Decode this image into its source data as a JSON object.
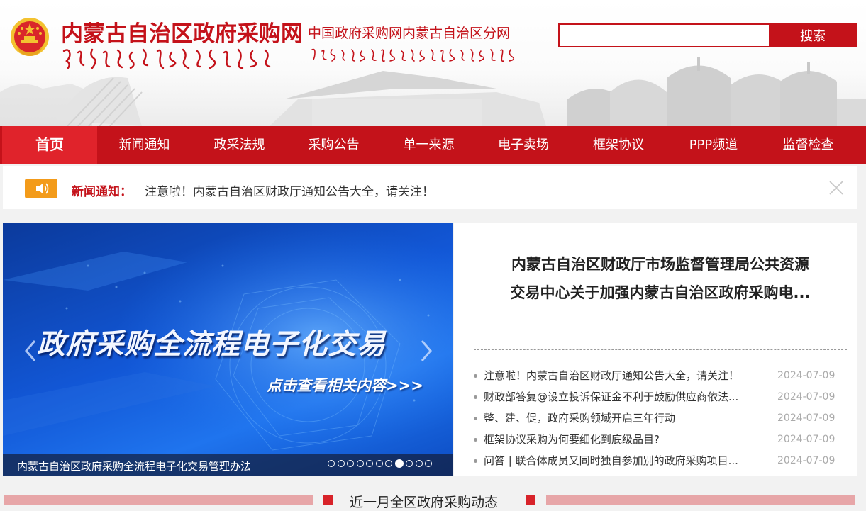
{
  "header": {
    "site_title": "内蒙古自治区政府采购网",
    "sub_title": "中国政府采购网内蒙古自治区分网",
    "emblem_icon": "national-emblem-icon",
    "search": {
      "placeholder": "",
      "button_label": "搜索"
    }
  },
  "nav": {
    "items": [
      {
        "label": "首页",
        "active": true
      },
      {
        "label": "新闻通知"
      },
      {
        "label": "政采法规"
      },
      {
        "label": "采购公告"
      },
      {
        "label": "单一来源"
      },
      {
        "label": "电子卖场"
      },
      {
        "label": "框架协议"
      },
      {
        "label": "PPP频道"
      },
      {
        "label": "监督检查"
      }
    ]
  },
  "notice": {
    "icon": "speaker-icon",
    "label": "新闻通知：",
    "text": "注意啦！内蒙古自治区财政厅通知公告大全，请关注！",
    "close_icon": "close-icon"
  },
  "carousel": {
    "headline": "政府采购全流程电子化交易",
    "cta": "点击查看相关内容>>>",
    "caption": "内蒙古自治区政府采购全流程电子化交易管理办法",
    "dot_count": 11,
    "active_dot": 7
  },
  "news": {
    "headline": "内蒙古自治区财政厅市场监督管理局公共资源交易中心关于加强内蒙古自治区政府采购电...",
    "items": [
      {
        "title": "注意啦！内蒙古自治区财政厅通知公告大全，请关注！",
        "date": "2024-07-09"
      },
      {
        "title": "财政部答复@设立投诉保证金不利于鼓励供应商依法...",
        "date": "2024-07-09"
      },
      {
        "title": "整、建、促，政府采购领域开启三年行动",
        "date": "2024-07-09"
      },
      {
        "title": "框架协议采购为何要细化到底级品目?",
        "date": "2024-07-09"
      },
      {
        "title": "问答 | 联合体成员又同时独自参加别的政府采购项目...",
        "date": "2024-07-09"
      }
    ]
  },
  "section": {
    "title": "近一月全区政府采购动态"
  },
  "colors": {
    "brand_red": "#c4121a",
    "nav_active": "#e0232b",
    "notice_orange": "#f39b1a"
  }
}
